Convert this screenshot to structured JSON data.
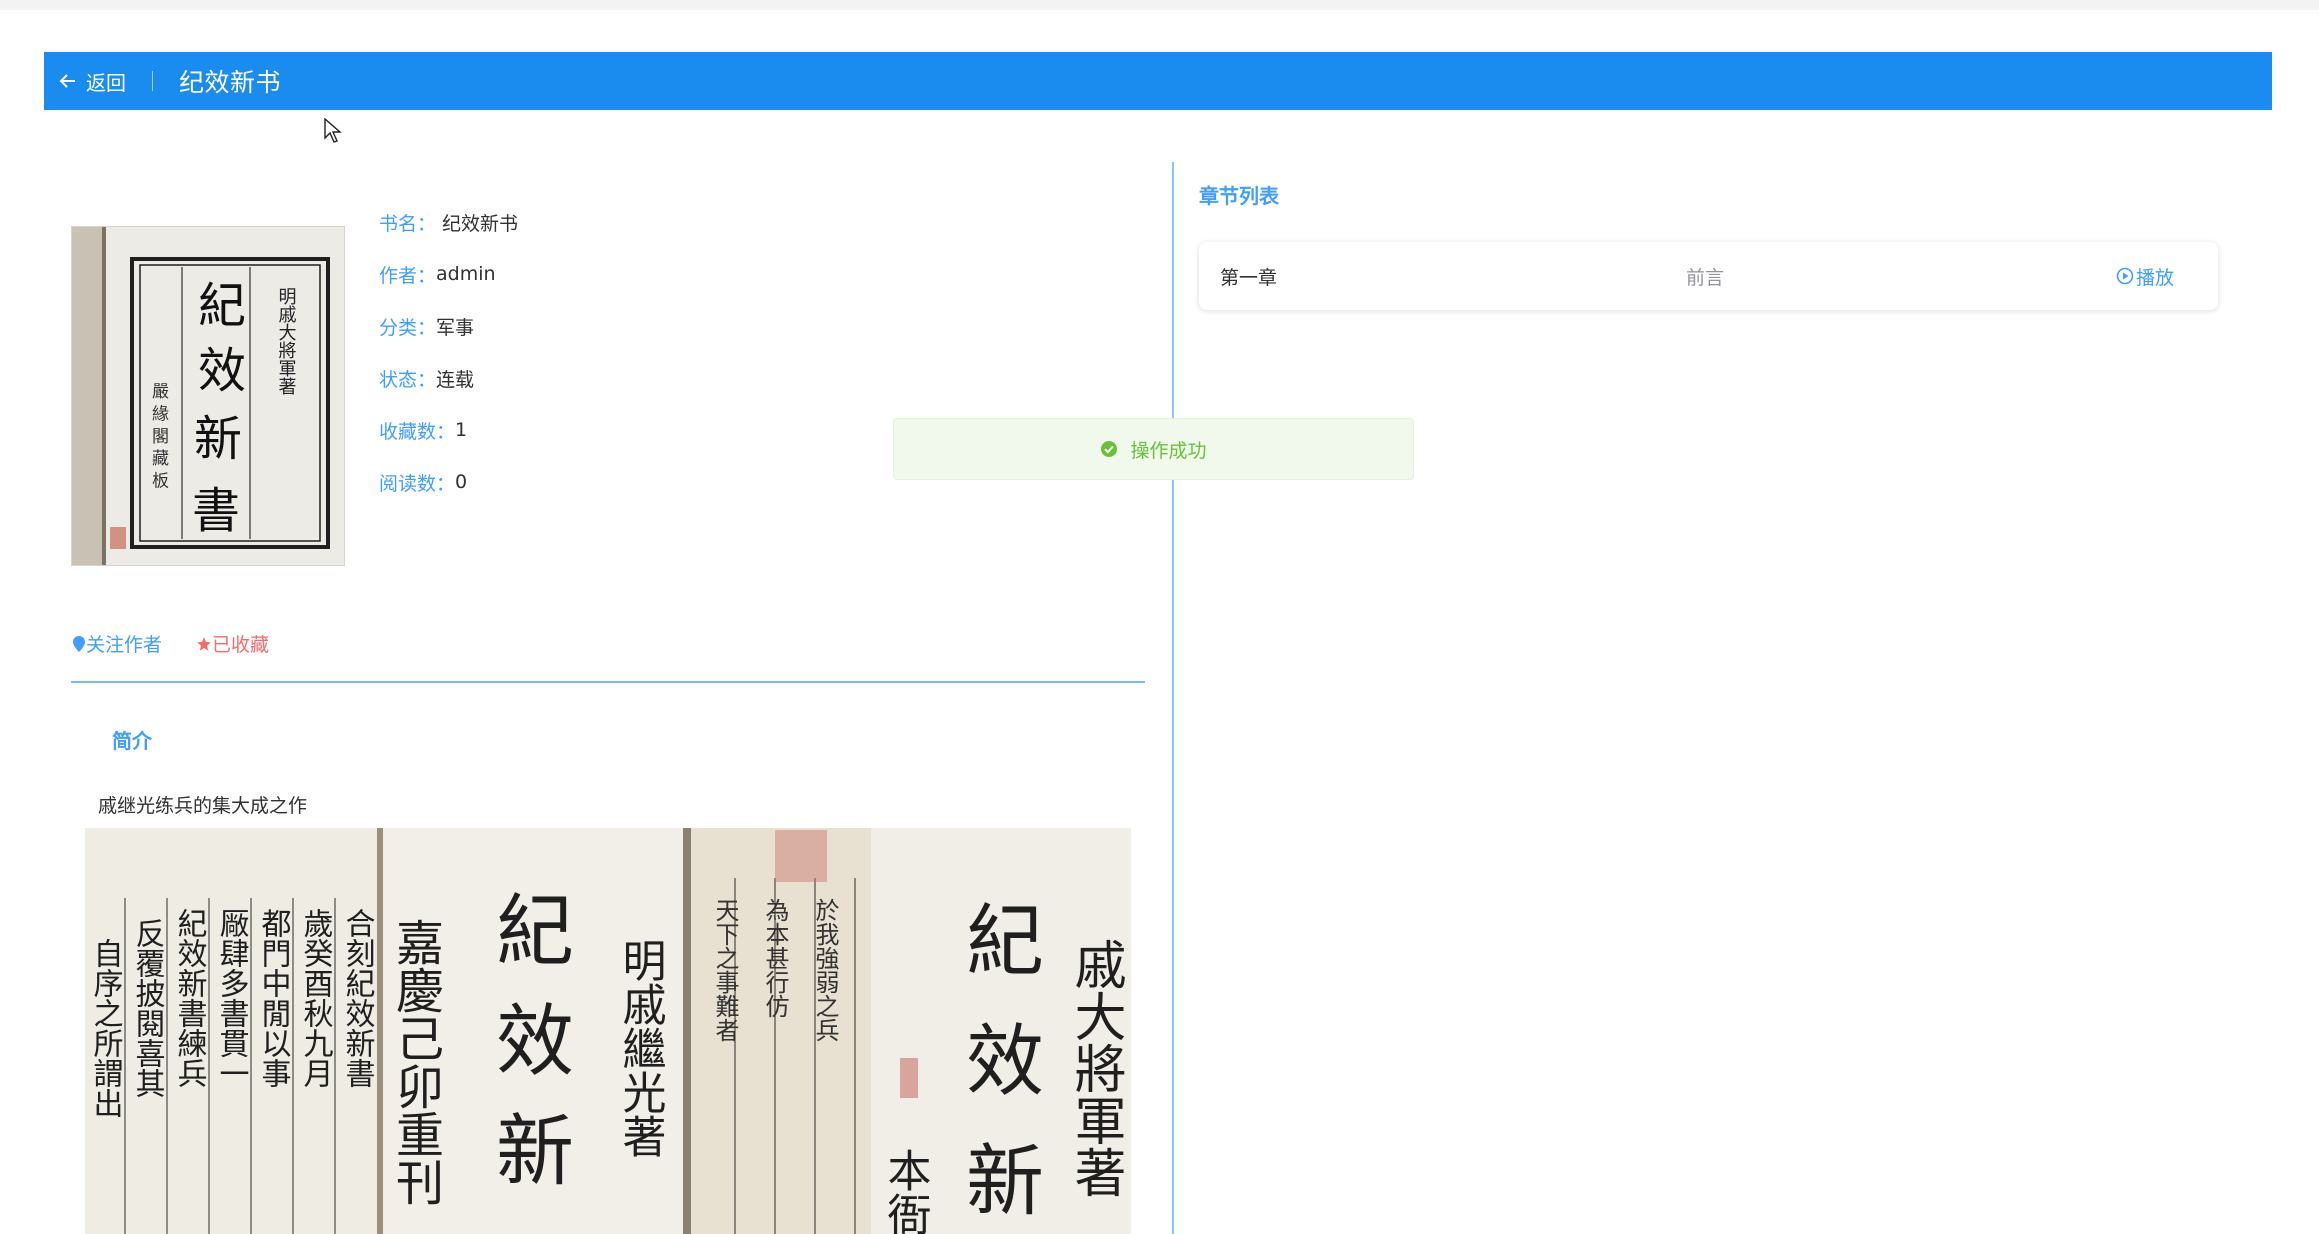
{
  "header": {
    "back_label": "返回",
    "title": "纪效新书"
  },
  "book": {
    "cover_text": [
      "紀",
      "效",
      "新",
      "書"
    ],
    "cover_side": "明戚大將軍著",
    "fields": [
      {
        "key": "书名：",
        "value": "纪效新书"
      },
      {
        "key": "作者：",
        "value": "admin"
      },
      {
        "key": "分类：",
        "value": "军事"
      },
      {
        "key": "状态：",
        "value": "连载"
      },
      {
        "key": "收藏数：",
        "value": "1"
      },
      {
        "key": "阅读数：",
        "value": "0"
      }
    ]
  },
  "actions": {
    "follow_label": "关注作者",
    "collect_label": "已收藏"
  },
  "intro": {
    "title": "简介",
    "text": "戚继光练兵的集大成之作"
  },
  "chapters": {
    "title": "章节列表",
    "items": [
      {
        "name": "第一章",
        "subtitle": "前言",
        "action": "播放"
      }
    ]
  },
  "toast": {
    "message": "操作成功"
  },
  "colors": {
    "header": "#1a8cf0",
    "primary": "#409eff",
    "danger": "#f56c6c",
    "success": "#67c23a"
  }
}
